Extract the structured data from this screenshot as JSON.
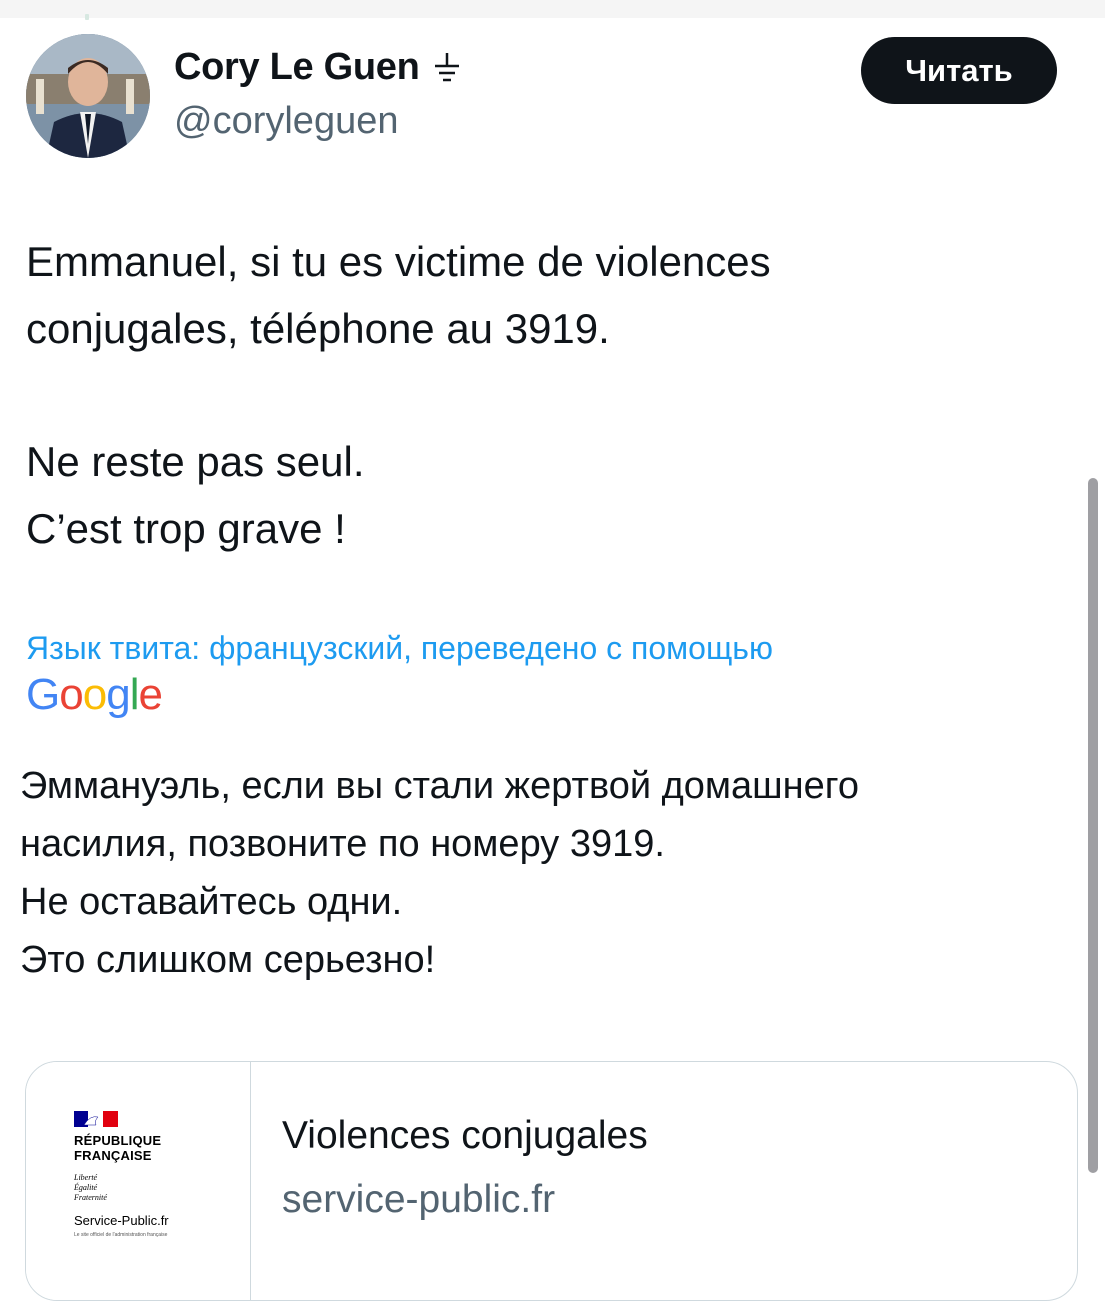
{
  "author": {
    "display_name": "Cory Le Guen",
    "handle": "@coryleguen",
    "affiliation_icon": "ground-symbol-icon"
  },
  "follow_button_label": "Читать",
  "tweet": {
    "lines": [
      "Emmanuel, si tu es victime de violences",
      "conjugales, téléphone au 3919.",
      "Ne reste pas seul.",
      "C’est trop grave !"
    ]
  },
  "translation": {
    "label": "Язык твита: французский, переведено с помощью",
    "provider_letters": [
      "G",
      "o",
      "o",
      "g",
      "l",
      "e"
    ],
    "provider_colors": [
      "#4285f4",
      "#ea4335",
      "#fbbc05",
      "#4285f4",
      "#34a853",
      "#ea4335"
    ],
    "lines": [
      "Эммануэль, если вы стали жертвой домашнего",
      "насилия, позвоните по номеру 3919.",
      "Не оставайтесь одни.",
      "Это слишком серьезно!"
    ]
  },
  "link_card": {
    "title": "Violences conjugales",
    "domain": "service-public.fr",
    "logo": {
      "line1": "RÉPUBLIQUE",
      "line2": "FRANÇAISE",
      "motto1": "Liberté",
      "motto2": "Égalité",
      "motto3": "Fraternité",
      "site_name": "Service-Public.fr",
      "site_sub": "Le site officiel de l'administration française"
    }
  },
  "colors": {
    "link_blue": "#1d9bf0",
    "secondary_text": "#536471",
    "primary_text": "#0f1419"
  }
}
